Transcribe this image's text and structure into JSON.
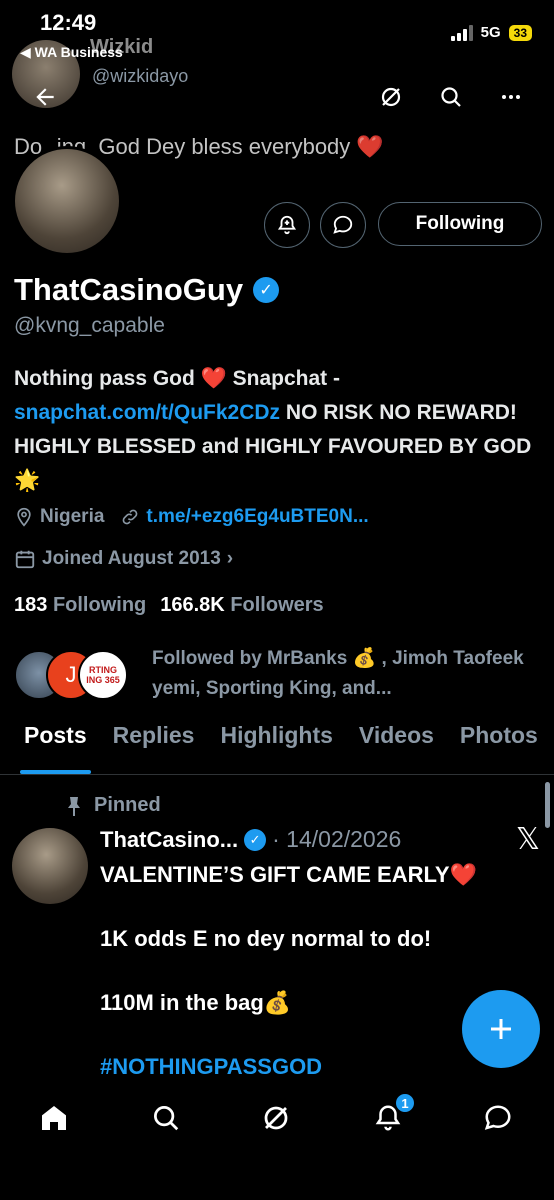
{
  "status_bar": {
    "time": "12:49",
    "back_app": "◀ WA Business",
    "network": "5G",
    "battery": "33"
  },
  "top_header": {
    "name": "Wizkid",
    "handle": "@wizkidayo",
    "prev_post_text": "Do‥ing. God Dey bless everybody ❤️"
  },
  "profile": {
    "display_name": "ThatCasinoGuy",
    "handle": "@kvng_capable",
    "follow_label": "Following",
    "bio_pre": "Nothing pass God ❤️ Snapchat - ",
    "bio_link": "snapchat.com/t/QuFk2CDz",
    "bio_post": " NO RISK NO REWARD! HIGHLY BLESSED and HIGHLY FAVOURED BY GOD🌟",
    "location": "Nigeria",
    "website": "t.me/+ezg6Eg4uBTE0N...",
    "joined": "Joined August 2013",
    "following_count": "183",
    "following_label": "Following",
    "followers_count": "166.8K",
    "followers_label": "Followers",
    "followed_by": "Followed by MrBanks 💰 , Jimoh Taofeek yemi, Sporting King, and...",
    "followed_avatar_2": "J",
    "followed_avatar_3": "RTING ING 365"
  },
  "tabs": [
    "Posts",
    "Replies",
    "Highlights",
    "Videos",
    "Photos"
  ],
  "post": {
    "pinned_label": "Pinned",
    "name": "ThatCasino...",
    "date": "· 14/02/2026",
    "line1": "VALENTINE’S GIFT CAME EARLY❤️",
    "line2": "1K odds E no dey normal to do!",
    "line3": "110M in the bag💰",
    "hashtag": "#NOTHINGPASSGOD"
  },
  "nav": {
    "notifications_badge": "1"
  },
  "icons": [
    "back-arrow-icon",
    "grok-icon",
    "search-icon",
    "more-icon",
    "notify-bell-icon",
    "message-icon",
    "verified-icon",
    "location-icon",
    "link-icon",
    "calendar-icon",
    "pin-icon",
    "x-logo-icon",
    "compose-icon",
    "home-icon",
    "explore-icon",
    "grok-nav-icon",
    "notifications-icon",
    "messages-icon"
  ],
  "colors": {
    "accent": "#1d9bf0",
    "muted": "#8b98a5",
    "background": "#000000"
  }
}
